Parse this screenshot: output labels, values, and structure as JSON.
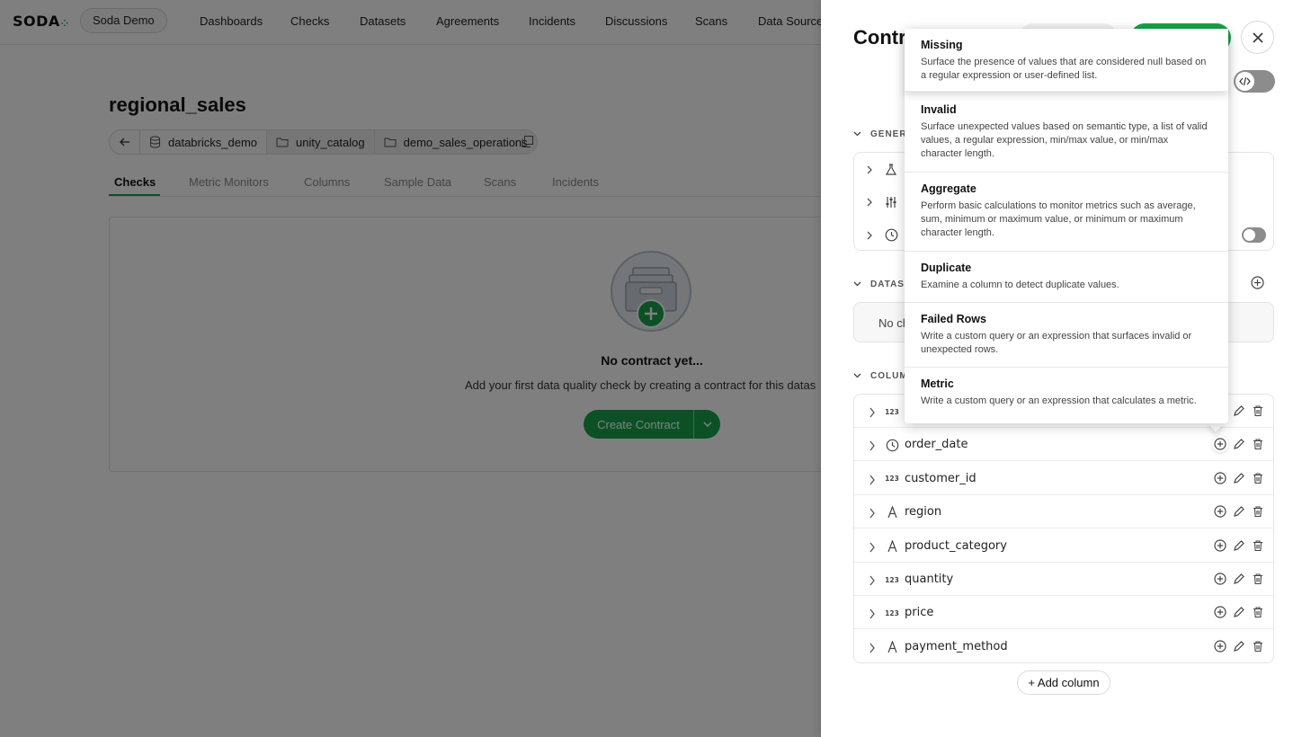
{
  "app": {
    "logo": "SODA",
    "org": "Soda Demo",
    "nav": [
      "Dashboards",
      "Checks",
      "Datasets",
      "Agreements",
      "Incidents",
      "Discussions",
      "Scans",
      "Data Sources"
    ]
  },
  "dataset": {
    "title": "regional_sales",
    "breadcrumbs": [
      "databricks_demo",
      "unity_catalog",
      "demo_sales_operations"
    ],
    "tabs": [
      "Checks",
      "Metric Monitors",
      "Columns",
      "Sample Data",
      "Scans",
      "Incidents"
    ],
    "active_tab": "Checks",
    "empty_title": "No contract yet...",
    "empty_subtitle": "Add your first data quality check by creating a contract for this datas",
    "create_button": "Create Contract"
  },
  "drawer": {
    "title": "Contr",
    "sections": {
      "general": "GENER",
      "dataset": "DATAS",
      "columns": "COLUM"
    },
    "dataset_empty": "No ch",
    "columns": [
      {
        "name": "",
        "type": "numeric"
      },
      {
        "name": "order_date",
        "type": "time"
      },
      {
        "name": "customer_id",
        "type": "numeric"
      },
      {
        "name": "region",
        "type": "text"
      },
      {
        "name": "product_category",
        "type": "text"
      },
      {
        "name": "quantity",
        "type": "numeric"
      },
      {
        "name": "price",
        "type": "numeric"
      },
      {
        "name": "payment_method",
        "type": "text"
      }
    ],
    "numeric_glyph": "123",
    "add_column": "+ Add column"
  },
  "menu": {
    "items": [
      {
        "title": "Missing",
        "desc": "Surface the presence of values that are considered null based on a regular expression or user-defined list."
      },
      {
        "title": "Invalid",
        "desc": "Surface unexpected values based on semantic type, a list of valid values, a regular expression, min/max value, or min/max character length."
      },
      {
        "title": "Aggregate",
        "desc": "Perform basic calculations to monitor metrics such as average, sum, minimum or maximum value, or minimum or maximum character length."
      },
      {
        "title": "Duplicate",
        "desc": "Examine a column to detect duplicate values."
      },
      {
        "title": "Failed Rows",
        "desc": "Write a custom query or an expression that surfaces invalid or unexpected rows."
      },
      {
        "title": "Metric",
        "desc": "Write a custom query or an expression that calculates a metric."
      }
    ]
  },
  "colors": {
    "accent": "#16a34a",
    "overlay": "rgba(0,0,0,0.5)"
  }
}
